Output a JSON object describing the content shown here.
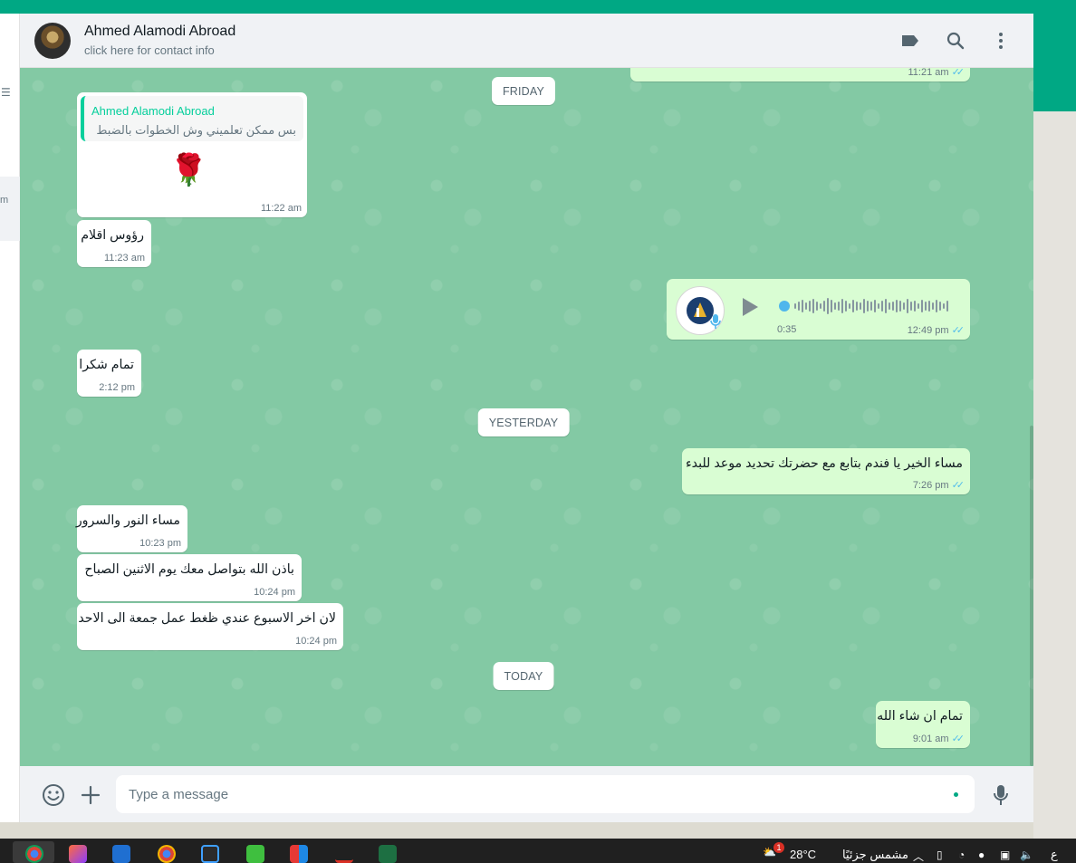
{
  "header": {
    "contact_name": "Ahmed Alamodi Abroad",
    "contact_sub": "click here for contact info",
    "icons": [
      "label-icon",
      "search-icon",
      "menu-icon"
    ]
  },
  "left_pane": {
    "fragment": "m"
  },
  "days": {
    "friday": "FRIDAY",
    "yesterday": "YESTERDAY",
    "today": "TODAY"
  },
  "messages": {
    "m0": {
      "time": "11:21 am"
    },
    "m1": {
      "quote_name": "Ahmed Alamodi Abroad",
      "quote_text": "بس ممكن تعلميني وش الخطوات بالضبط",
      "sticker": "🌹",
      "time": "11:22 am"
    },
    "m2": {
      "text": "رؤوس اقلام",
      "time": "11:23 am"
    },
    "m3": {
      "duration": "0:35",
      "time": "12:49 pm"
    },
    "m4": {
      "text": "تمام شكرا",
      "time": "2:12 pm"
    },
    "m5": {
      "text": "مساء الخير يا فندم بتابع مع حضرتك تحديد موعد للبدء",
      "time": "7:26 pm"
    },
    "m6": {
      "text": "مساء النور والسرور",
      "time": "10:23 pm"
    },
    "m7": {
      "text": "باذن الله بتواصل معك يوم الاثنين الصباح",
      "time": "10:24 pm"
    },
    "m8": {
      "text": "لان اخر الاسبوع عندي ظغط عمل جمعة الى الاحد",
      "time": "10:24 pm"
    },
    "m9": {
      "text": "تمام ان شاء الله",
      "time": "9:01 am"
    }
  },
  "footer": {
    "placeholder": "Type a message",
    "icons": [
      "emoji-icon",
      "attach-icon",
      "mic-icon"
    ]
  },
  "taskbar": {
    "temperature": "28°C",
    "weather": "مشمس جزئيًا",
    "lang": "ع",
    "notif_count": "1"
  },
  "colors": {
    "accent": "#00a884",
    "chat_bg": "#83c9a4",
    "incoming": "#ffffff",
    "outgoing": "#d9fdd3",
    "ticks": "#53bdeb"
  }
}
